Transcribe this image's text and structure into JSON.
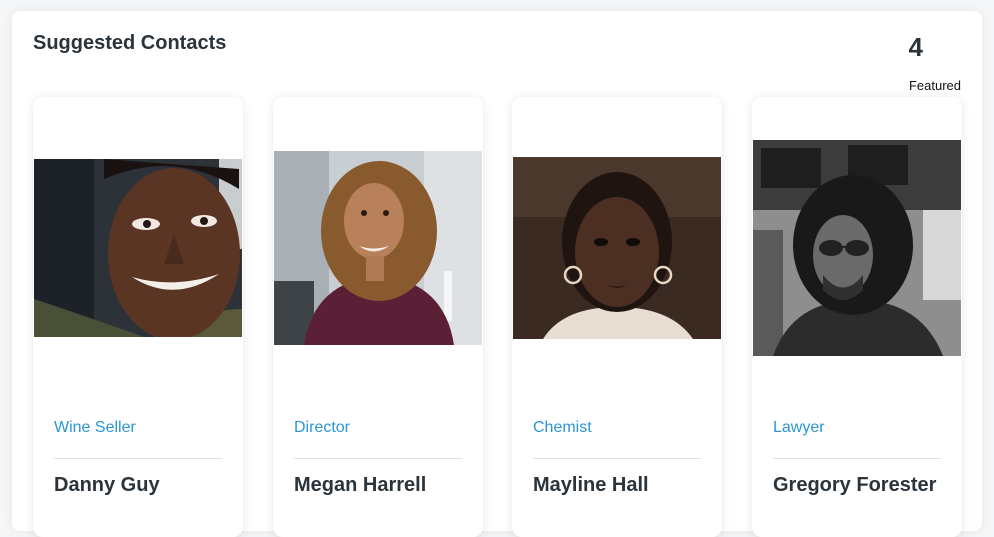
{
  "section": {
    "title": "Suggested Contacts",
    "featured_count": "4",
    "featured_label": "Featured"
  },
  "contacts": [
    {
      "role": "Wine Seller",
      "name": "Danny Guy",
      "photo_icon": "portrait-photo"
    },
    {
      "role": "Director",
      "name": "Megan Harrell",
      "photo_icon": "portrait-photo"
    },
    {
      "role": "Chemist",
      "name": "Mayline Hall",
      "photo_icon": "portrait-photo"
    },
    {
      "role": "Lawyer",
      "name": "Gregory Forester",
      "photo_icon": "portrait-photo"
    }
  ],
  "colors": {
    "role_text": "#2b96d1",
    "heading_text": "#2b333b",
    "card_background": "#ffffff"
  }
}
